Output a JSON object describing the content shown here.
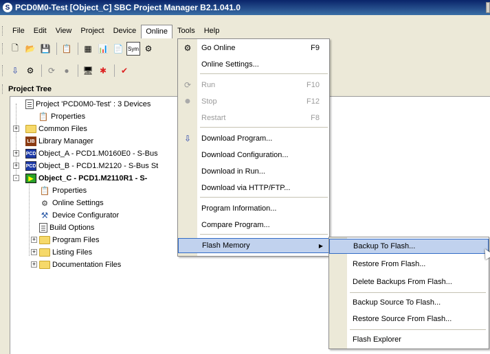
{
  "window": {
    "title": "PCD0M0-Test [Object_C]  SBC Project Manager B2.1.041.0",
    "app_icon": "S"
  },
  "menubar": {
    "items": [
      "File",
      "Edit",
      "View",
      "Project",
      "Device",
      "Online",
      "Tools",
      "Help"
    ],
    "active": "Online"
  },
  "toolbar1": {
    "icons": [
      "new-icon",
      "open-icon",
      "save-icon",
      "properties-icon",
      "grid-icon",
      "chart-icon",
      "document-icon",
      "symbol-icon",
      "online-icon"
    ]
  },
  "toolbar2": {
    "icons": [
      "download-icon",
      "online-settings-icon",
      "run-icon",
      "stop-icon",
      "monitor-icon",
      "error-icon",
      "check-icon"
    ]
  },
  "project_tree": {
    "header": "Project Tree",
    "nodes": [
      {
        "label": "Project 'PCD0M0-Test' : 3 Devices",
        "icon": "project-icon",
        "level": 1
      },
      {
        "label": "Properties",
        "icon": "properties-icon",
        "level": 2
      },
      {
        "label": "Common Files",
        "icon": "folder-icon",
        "level": 1,
        "expander": "+"
      },
      {
        "label": "Library Manager",
        "icon": "library-icon",
        "level": 1
      },
      {
        "label": "Object_A - PCD1.M0160E0 - S-Bus",
        "icon": "pcd-icon",
        "level": 1,
        "expander": "+"
      },
      {
        "label": "Object_B - PCD1.M2120 - S-Bus St",
        "icon": "pcd-icon",
        "level": 1,
        "expander": "+"
      },
      {
        "label": "Object_C - PCD1.M2110R1 - S-",
        "icon": "active-device-icon",
        "level": 1,
        "expander": "-",
        "bold": true
      },
      {
        "label": "Properties",
        "icon": "properties-icon",
        "level": 2
      },
      {
        "label": "Online Settings",
        "icon": "online-settings-icon",
        "level": 2
      },
      {
        "label": "Device Configurator",
        "icon": "device-configurator-icon",
        "level": 2
      },
      {
        "label": "Build Options",
        "icon": "build-options-icon",
        "level": 2
      },
      {
        "label": "Program Files",
        "icon": "folder-icon",
        "level": 2,
        "expander": "+"
      },
      {
        "label": "Listing Files",
        "icon": "folder-icon",
        "level": 2,
        "expander": "+"
      },
      {
        "label": "Documentation Files",
        "icon": "folder-icon",
        "level": 2,
        "expander": "+"
      }
    ]
  },
  "online_menu": {
    "items": [
      {
        "label": "Go Online",
        "shortcut": "F9",
        "icon": "online-icon",
        "enabled": true
      },
      {
        "label": "Online Settings...",
        "shortcut": "",
        "icon": "",
        "enabled": true
      },
      {
        "label": "Run",
        "shortcut": "F10",
        "icon": "run-icon",
        "enabled": false
      },
      {
        "label": "Stop",
        "shortcut": "F12",
        "icon": "stop-icon",
        "enabled": false
      },
      {
        "label": "Restart",
        "shortcut": "F8",
        "icon": "",
        "enabled": false
      },
      {
        "label": "Download Program...",
        "shortcut": "",
        "icon": "download-icon",
        "enabled": true
      },
      {
        "label": "Download Configuration...",
        "shortcut": "",
        "icon": "",
        "enabled": true
      },
      {
        "label": "Download in Run...",
        "shortcut": "",
        "icon": "",
        "enabled": true
      },
      {
        "label": "Download via HTTP/FTP...",
        "shortcut": "",
        "icon": "",
        "enabled": true
      },
      {
        "label": "Program Information...",
        "shortcut": "",
        "icon": "",
        "enabled": true
      },
      {
        "label": "Compare Program...",
        "shortcut": "",
        "icon": "",
        "enabled": true
      },
      {
        "label": "Flash Memory",
        "shortcut": "",
        "icon": "",
        "enabled": true,
        "submenu": true,
        "highlighted": true
      }
    ]
  },
  "flash_submenu": {
    "items": [
      {
        "label": "Backup To Flash...",
        "highlighted": true
      },
      {
        "label": "Restore From Flash..."
      },
      {
        "label": "Delete Backups From Flash..."
      },
      {
        "label": "Backup Source To Flash..."
      },
      {
        "label": "Restore Source From Flash..."
      },
      {
        "label": "Flash Explorer"
      }
    ]
  },
  "colors": {
    "selection_bg": "#c1d2ee",
    "selection_border": "#316ac5",
    "menu_gutter": "#ece9d8",
    "title_bar": "#0a246a"
  }
}
